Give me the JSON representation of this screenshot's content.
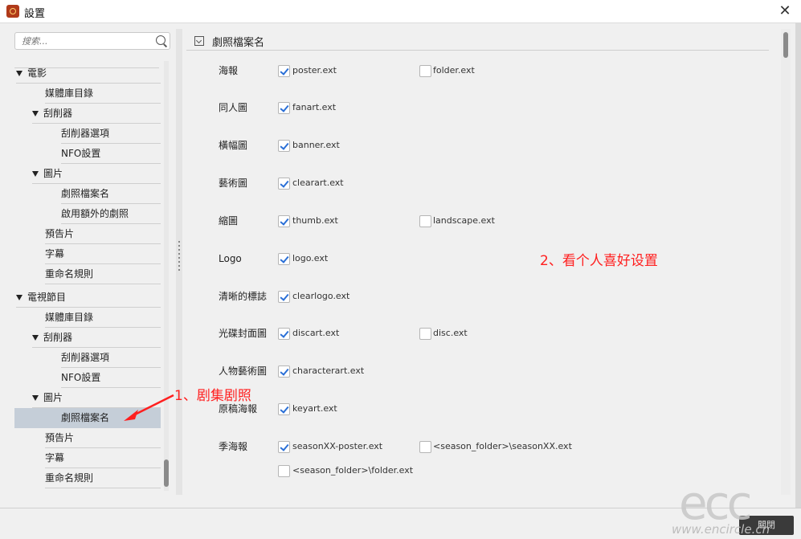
{
  "window": {
    "title": "設置",
    "close": "✕"
  },
  "search": {
    "placeholder": "搜索..."
  },
  "tree": {
    "items": [
      {
        "label": "",
        "level": 0,
        "expanded": false
      },
      {
        "label": "電影",
        "level": 0,
        "expanded": true
      },
      {
        "label": "媒體庫目錄",
        "level": 1,
        "expanded": false
      },
      {
        "label": "刮削器",
        "level": 1,
        "expanded": true
      },
      {
        "label": "刮削器選項",
        "level": 2,
        "expanded": false
      },
      {
        "label": "NFO設置",
        "level": 2,
        "expanded": false
      },
      {
        "label": "圖片",
        "level": 1,
        "expanded": true
      },
      {
        "label": "劇照檔案名",
        "level": 2,
        "expanded": false
      },
      {
        "label": "啟用額外的劇照",
        "level": 2,
        "expanded": false
      },
      {
        "label": "預告片",
        "level": 1,
        "expanded": false
      },
      {
        "label": "字幕",
        "level": 1,
        "expanded": false
      },
      {
        "label": "重命名規則",
        "level": 1,
        "expanded": false
      },
      {
        "label": "電視節目",
        "level": 0,
        "expanded": true
      },
      {
        "label": "媒體庫目錄",
        "level": 1,
        "expanded": false
      },
      {
        "label": "刮削器",
        "level": 1,
        "expanded": true
      },
      {
        "label": "刮削器選項",
        "level": 2,
        "expanded": false
      },
      {
        "label": "NFO設置",
        "level": 2,
        "expanded": false
      },
      {
        "label": "圖片",
        "level": 1,
        "expanded": true
      },
      {
        "label": "劇照檔案名",
        "level": 2,
        "expanded": false,
        "selected": true
      },
      {
        "label": "預告片",
        "level": 1,
        "expanded": false
      },
      {
        "label": "字幕",
        "level": 1,
        "expanded": false
      },
      {
        "label": "重命名規則",
        "level": 1,
        "expanded": false
      }
    ]
  },
  "section": {
    "title": "劇照檔案名"
  },
  "rows": [
    {
      "label": "海報",
      "options": [
        {
          "text": "poster.ext",
          "checked": true
        },
        {
          "text": "folder.ext",
          "checked": false
        }
      ]
    },
    {
      "label": "同人圖",
      "options": [
        {
          "text": "fanart.ext",
          "checked": true
        }
      ]
    },
    {
      "label": "橫幅圖",
      "options": [
        {
          "text": "banner.ext",
          "checked": true
        }
      ]
    },
    {
      "label": "藝術圖",
      "options": [
        {
          "text": "clearart.ext",
          "checked": true
        }
      ]
    },
    {
      "label": "縮圖",
      "options": [
        {
          "text": "thumb.ext",
          "checked": true
        },
        {
          "text": "landscape.ext",
          "checked": false
        }
      ]
    },
    {
      "label": "Logo",
      "options": [
        {
          "text": "logo.ext",
          "checked": true
        }
      ]
    },
    {
      "label": "清晰的標誌",
      "options": [
        {
          "text": "clearlogo.ext",
          "checked": true
        }
      ]
    },
    {
      "label": "光碟封面圖",
      "options": [
        {
          "text": "discart.ext",
          "checked": true
        },
        {
          "text": "disc.ext",
          "checked": false
        }
      ]
    },
    {
      "label": "人物藝術圖",
      "options": [
        {
          "text": "characterart.ext",
          "checked": true
        }
      ]
    },
    {
      "label": "原稿海報",
      "options": [
        {
          "text": "keyart.ext",
          "checked": true
        }
      ]
    },
    {
      "label": "季海報",
      "options": [
        {
          "text": "seasonXX-poster.ext",
          "checked": true
        },
        {
          "text": "<season_folder>\\seasonXX.ext",
          "checked": false
        },
        {
          "text": "<season_folder>\\folder.ext",
          "checked": false
        }
      ]
    }
  ],
  "annotations": {
    "step1": "1、剧集剧照",
    "step2": "2、看个人喜好设置"
  },
  "footer": {
    "close_label": "關閉"
  },
  "watermark": {
    "logo": "ecc",
    "url": "www.encircle.cn"
  },
  "colors": {
    "check": "#2a6fd6",
    "annotation": "#ff1f1f",
    "selected": "#c5ced8"
  }
}
